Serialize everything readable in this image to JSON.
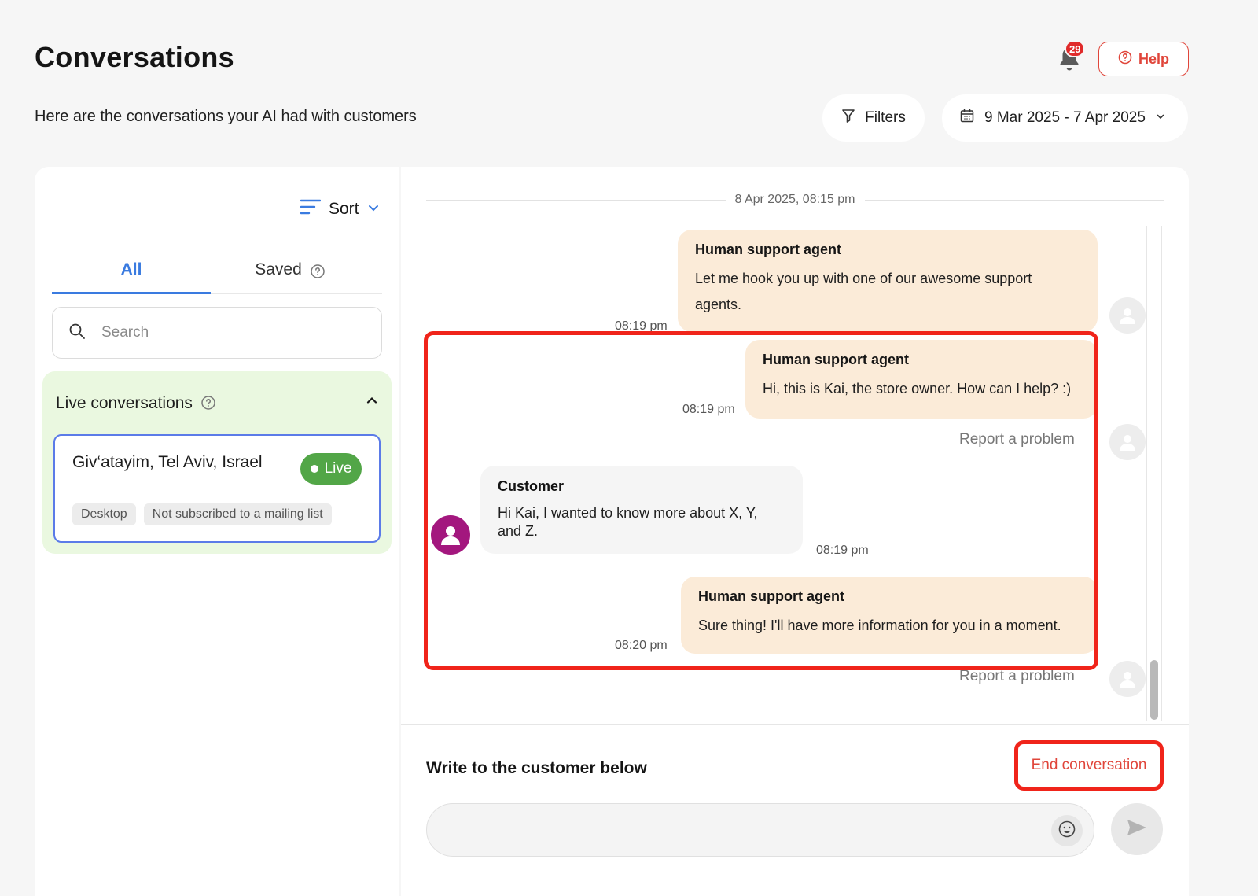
{
  "header": {
    "title": "Conversations",
    "subtitle": "Here are the conversations your AI had with customers",
    "notification_count": "29",
    "help_label": "Help",
    "filters_label": "Filters",
    "date_range": "9 Mar 2025 - 7 Apr 2025"
  },
  "sidebar": {
    "sort_label": "Sort",
    "tabs": [
      {
        "label": "All",
        "active": true
      },
      {
        "label": "Saved",
        "active": false
      }
    ],
    "search_placeholder": "Search",
    "live_section": {
      "title": "Live conversations",
      "conversation": {
        "location": "Giv‘atayim, Tel Aviv, Israel",
        "status": "Live",
        "tags": [
          "Desktop",
          "Not subscribed to a mailing list"
        ]
      }
    }
  },
  "chat": {
    "date_divider": "8 Apr 2025, 08:15 pm",
    "messages": [
      {
        "sender": "Human support agent",
        "text_line1": "Let me hook you up with one of our awesome support",
        "text_line2": "agents.",
        "time": "08:19 pm"
      },
      {
        "sender": "Human support agent",
        "text": "Hi, this is Kai, the store owner. How can I help? :)",
        "time": "08:19 pm",
        "report": "Report a problem"
      },
      {
        "sender": "Customer",
        "text_line1": "Hi Kai, I wanted to know more about X, Y,",
        "text_line2": "and Z.",
        "time": "08:19 pm"
      },
      {
        "sender": "Human support agent",
        "text": "Sure thing! I'll have more information for you in a moment.",
        "time": "08:20 pm",
        "report": "Report a problem"
      }
    ],
    "composer": {
      "label": "Write to the customer below",
      "end_label": "End conversation",
      "input_value": ""
    }
  },
  "colors": {
    "accent_blue": "#3a7be0",
    "help_red": "#e0453a",
    "live_green": "#52a647",
    "agent_bubble": "#fbebd8",
    "highlight_red": "#f0241a",
    "customer_avatar": "#a3177e"
  }
}
